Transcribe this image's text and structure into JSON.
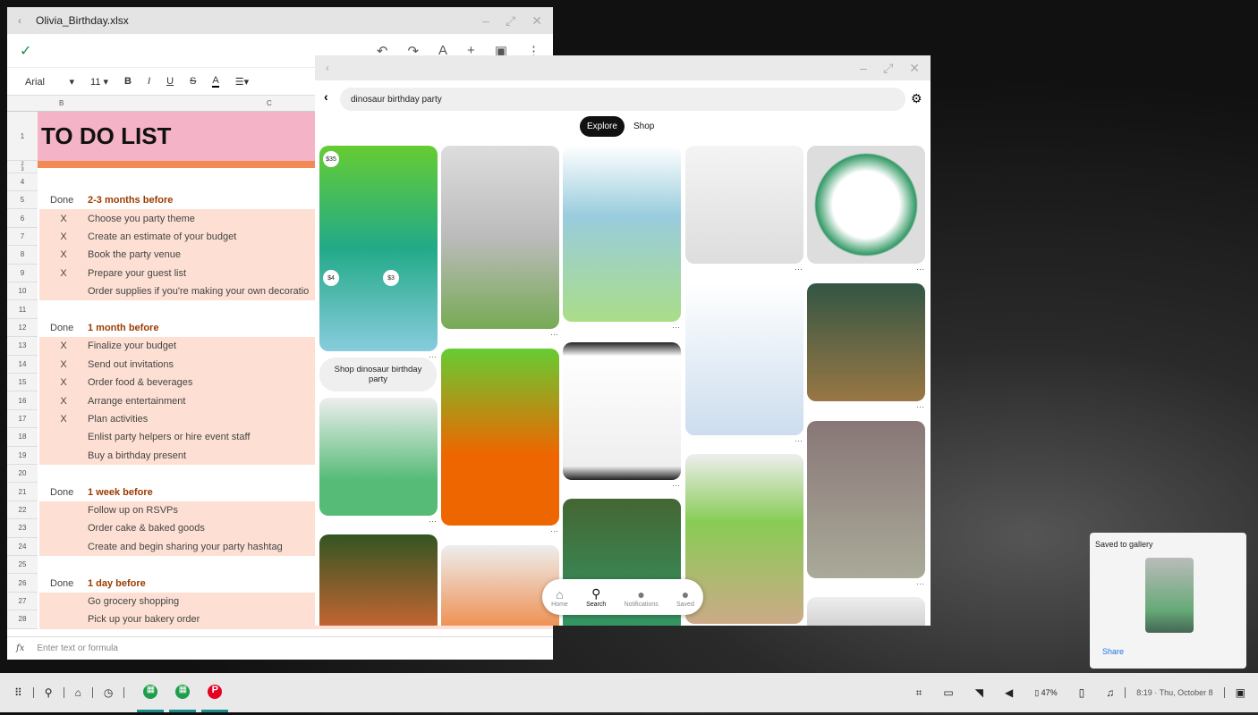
{
  "sheet": {
    "title": "Olivia_Birthday.xlsx",
    "font": "Arial",
    "size": "11",
    "col_b": "B",
    "col_c": "C",
    "heading": "TO DO LIST",
    "formula_placeholder": "Enter text or formula",
    "rows": [
      {
        "n": "4",
        "t": "blank"
      },
      {
        "n": "5",
        "t": "head",
        "a": "Done",
        "b": "2-3 months before"
      },
      {
        "n": "6",
        "t": "item",
        "a": "X",
        "b": "Choose you party theme"
      },
      {
        "n": "7",
        "t": "item",
        "a": "X",
        "b": "Create an estimate of your budget"
      },
      {
        "n": "8",
        "t": "item",
        "a": "X",
        "b": "Book the party venue"
      },
      {
        "n": "9",
        "t": "item",
        "a": "X",
        "b": "Prepare your guest list"
      },
      {
        "n": "10",
        "t": "item",
        "a": "",
        "b": "Order supplies if you're making your own decoratio"
      },
      {
        "n": "11",
        "t": "blank"
      },
      {
        "n": "12",
        "t": "head",
        "a": "Done",
        "b": "1 month before"
      },
      {
        "n": "13",
        "t": "item",
        "a": "X",
        "b": "Finalize your budget"
      },
      {
        "n": "14",
        "t": "item",
        "a": "X",
        "b": "Send out invitations"
      },
      {
        "n": "15",
        "t": "item",
        "a": "X",
        "b": "Order food & beverages"
      },
      {
        "n": "16",
        "t": "item",
        "a": "X",
        "b": "Arrange entertainment"
      },
      {
        "n": "17",
        "t": "item",
        "a": "X",
        "b": "Plan activities"
      },
      {
        "n": "18",
        "t": "item",
        "a": "",
        "b": "Enlist party helpers or hire event staff"
      },
      {
        "n": "19",
        "t": "item",
        "a": "",
        "b": "Buy a birthday present"
      },
      {
        "n": "20",
        "t": "blank"
      },
      {
        "n": "21",
        "t": "head",
        "a": "Done",
        "b": "1 week before"
      },
      {
        "n": "22",
        "t": "item",
        "a": "",
        "b": "Follow up on RSVPs"
      },
      {
        "n": "23",
        "t": "item",
        "a": "",
        "b": "Order cake & baked goods"
      },
      {
        "n": "24",
        "t": "item",
        "a": "",
        "b": "Create and begin sharing your party hashtag"
      },
      {
        "n": "25",
        "t": "blank"
      },
      {
        "n": "26",
        "t": "head",
        "a": "Done",
        "b": "1 day before"
      },
      {
        "n": "27",
        "t": "item",
        "a": "",
        "b": "Go grocery shopping"
      },
      {
        "n": "28",
        "t": "item",
        "a": "",
        "b": "Pick up your bakery order"
      }
    ]
  },
  "pinterest": {
    "query": "dinosaur birthday party",
    "tabs": [
      "Explore",
      "Shop"
    ],
    "shop_label": "Shop dinosaur birthday party",
    "prices": [
      "$35",
      "$4",
      "$3"
    ],
    "nav": [
      "Home",
      "Search",
      "Notifications",
      "Saved"
    ]
  },
  "toast": {
    "title": "Saved to gallery",
    "action": "Share"
  },
  "taskbar": {
    "battery": "47%",
    "clock": "8:19 · Thu, October 8"
  },
  "colors": {
    "heading_bg": "#f4b3c6",
    "orange_band": "#f28a55",
    "pink_row": "#fde0d3",
    "header_text": "#9a3b00",
    "share": "#1a73e8"
  }
}
